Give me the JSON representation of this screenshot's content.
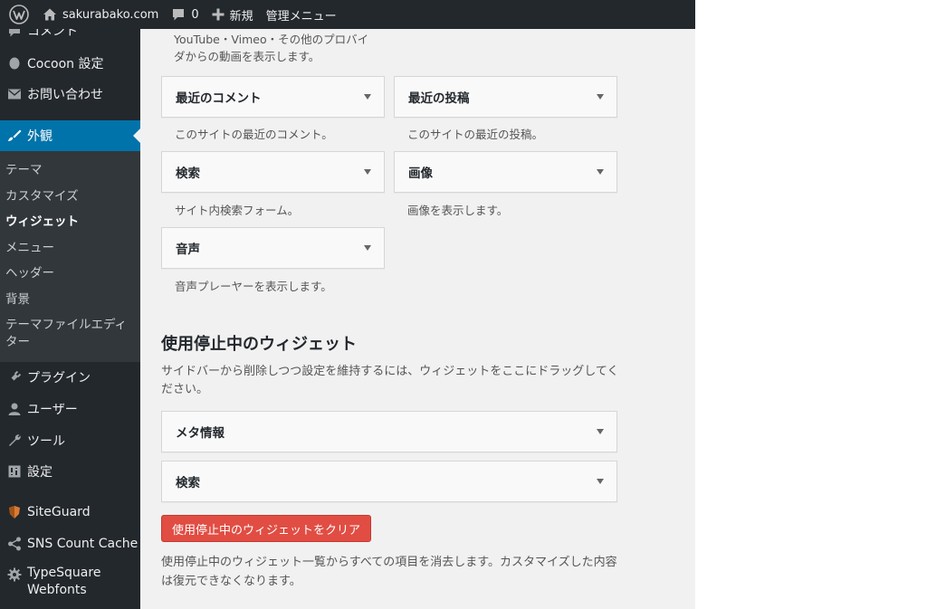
{
  "adminbar": {
    "site_name": "sakurabako.com",
    "comment_count": "0",
    "new_label": "新規",
    "menu_label": "管理メニュー"
  },
  "sidebar": {
    "items": [
      {
        "label": "コメント",
        "icon": "comment-icon"
      },
      {
        "label": "Cocoon 設定",
        "icon": "cocoon-icon"
      },
      {
        "label": "お問い合わせ",
        "icon": "mail-icon"
      },
      {
        "label": "外観",
        "icon": "appearance-brush-icon"
      },
      {
        "label": "プラグイン",
        "icon": "plugin-icon"
      },
      {
        "label": "ユーザー",
        "icon": "user-icon"
      },
      {
        "label": "ツール",
        "icon": "wrench-icon"
      },
      {
        "label": "設定",
        "icon": "settings-icon"
      },
      {
        "label": "SiteGuard",
        "icon": "siteguard-shield-icon"
      },
      {
        "label": "SNS Count Cache",
        "icon": "share-icon"
      },
      {
        "label": "TypeSquare Webfonts",
        "icon": "gear-icon"
      }
    ],
    "submenu": [
      {
        "label": "テーマ"
      },
      {
        "label": "カスタマイズ"
      },
      {
        "label": "ウィジェット"
      },
      {
        "label": "メニュー"
      },
      {
        "label": "ヘッダー"
      },
      {
        "label": "背景"
      },
      {
        "label": "テーマファイルエディター"
      }
    ]
  },
  "main": {
    "top_desc": "YouTube・Vimeo・その他のプロバイダからの動画を表示します。",
    "available_widgets": [
      {
        "title": "最近のコメント",
        "desc": "このサイトの最近のコメント。"
      },
      {
        "title": "最近の投稿",
        "desc": "このサイトの最近の投稿。"
      },
      {
        "title": "検索",
        "desc": "サイト内検索フォーム。"
      },
      {
        "title": "画像",
        "desc": "画像を表示します。"
      },
      {
        "title": "音声",
        "desc": "音声プレーヤーを表示します。"
      }
    ],
    "inactive": {
      "title": "使用停止中のウィジェット",
      "desc": "サイドバーから削除しつつ設定を維持するには、ウィジェットをここにドラッグしてください。",
      "widgets": [
        {
          "title": "メタ情報"
        },
        {
          "title": "検索"
        }
      ],
      "clear_button": "使用停止中のウィジェットをクリア",
      "clear_desc": "使用停止中のウィジェット一覧からすべての項目を消去します。カスタマイズした内容は復元できなくなります。"
    }
  },
  "colors": {
    "sidebar_bg": "#23282d",
    "submenu_bg": "#32373c",
    "current_menu": "#0073aa",
    "danger_button": "#e14d43",
    "content_bg": "#f1f1f1"
  }
}
